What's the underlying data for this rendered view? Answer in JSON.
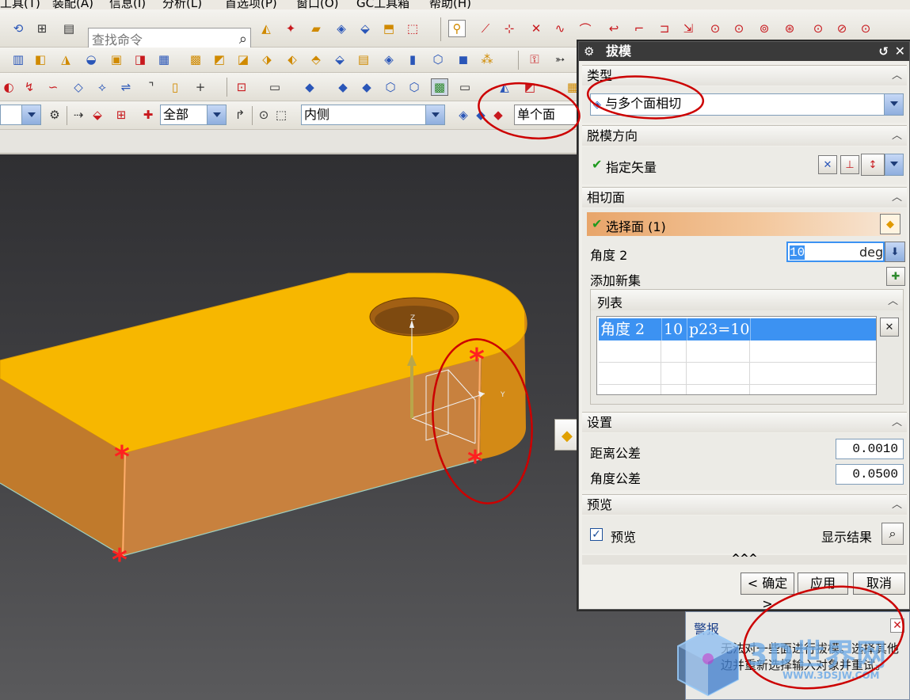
{
  "menubar": {
    "items": [
      "工具(T)",
      "装配(A)",
      "信息(I)",
      "分析(L)",
      "首选项(P)",
      "窗口(O)",
      "GC工具箱",
      "帮助(H)"
    ]
  },
  "search": {
    "placeholder": "查找命令",
    "icon": "magnifier-icon"
  },
  "toolbar": {
    "filter_scope": "全部",
    "face_side": "内侧",
    "face_rule": "单个面"
  },
  "dialog": {
    "title": "拔模",
    "type_section": {
      "header": "类型",
      "value": "与多个面相切"
    },
    "direction_section": {
      "header": "脱模方向",
      "label": "指定矢量"
    },
    "tangent_section": {
      "header": "相切面",
      "select_face": "选择面 (1)",
      "angle_label": "角度 2",
      "angle_value": "10",
      "angle_unit": "deg",
      "add_set": "添加新集"
    },
    "list_section": {
      "header": "列表",
      "rows": [
        {
          "name": "角度 2",
          "value": "10",
          "expr": "p23=10"
        }
      ]
    },
    "settings_section": {
      "header": "设置",
      "distance_tol_label": "距离公差",
      "distance_tol": "0.0010",
      "angle_tol_label": "角度公差",
      "angle_tol": "0.0500"
    },
    "preview_section": {
      "header": "预览",
      "preview_label": "预览",
      "preview_checked": true,
      "show_result": "显示结果"
    },
    "more": "^^^",
    "buttons": {
      "ok": "< 确定 >",
      "apply": "应用",
      "cancel": "取消"
    }
  },
  "warning": {
    "title": "警报",
    "message": "无法对一些面进行拔模。选择其他边并重新选择输入对象并重试。"
  },
  "viewport": {
    "axes": {
      "z": "Z",
      "y": "Y"
    },
    "model_color": "#f5b400",
    "side_color": "#c68a3c",
    "marker_color": "#ff2020"
  },
  "watermark": {
    "text": "3D世界网",
    "url": "WWW.3DSJW.COM"
  },
  "colors": {
    "annotation": "#cc0000",
    "selection": "#3c92f2",
    "dialog_title_bg": "#3a3a3a"
  }
}
